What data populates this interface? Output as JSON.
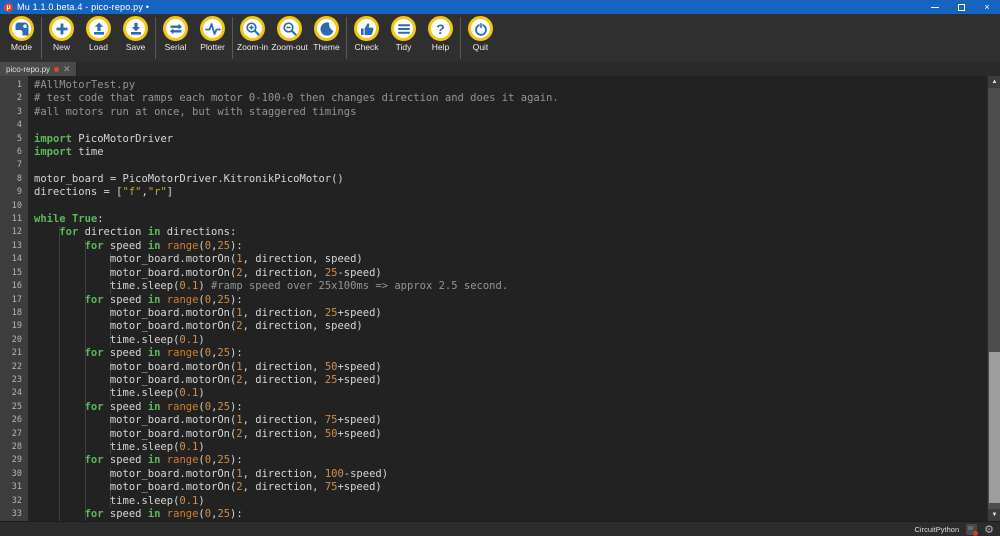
{
  "titlebar": {
    "title": "Mu 1.1.0.beta.4 - pico-repo.py •"
  },
  "toolbar": {
    "buttons": [
      {
        "name": "mode",
        "label": "Mode"
      },
      {
        "name": "new",
        "label": "New"
      },
      {
        "name": "load",
        "label": "Load"
      },
      {
        "name": "save",
        "label": "Save"
      },
      {
        "name": "serial",
        "label": "Serial"
      },
      {
        "name": "plotter",
        "label": "Plotter"
      },
      {
        "name": "zoom-in",
        "label": "Zoom-in"
      },
      {
        "name": "zoom-out",
        "label": "Zoom-out"
      },
      {
        "name": "theme",
        "label": "Theme"
      },
      {
        "name": "check",
        "label": "Check"
      },
      {
        "name": "tidy",
        "label": "Tidy"
      },
      {
        "name": "help",
        "label": "Help"
      },
      {
        "name": "quit",
        "label": "Quit"
      }
    ]
  },
  "tabbar": {
    "active_tab": "pico-repo.py"
  },
  "statusbar": {
    "mode": "CircuitPython"
  },
  "colors": {
    "titlebar_blue": "#1565c0",
    "icon_ring_yellow": "#f3c713",
    "icon_glyph_blue": "#2b6cb0",
    "editor_bg": "#222222",
    "keyword_green": "#5db85a",
    "number_orange": "#cf8f4e",
    "string_gold": "#cfa331",
    "comment_gray": "#949494",
    "modified_dot_red": "#e0492e"
  },
  "editor": {
    "lines": [
      {
        "tokens": [
          [
            "c",
            "#AllMotorTest.py"
          ]
        ]
      },
      {
        "tokens": [
          [
            "c",
            "# test code that ramps each motor 0-100-0 then changes direction and does it again."
          ]
        ]
      },
      {
        "tokens": [
          [
            "c",
            "#all motors run at once, but with staggered timings"
          ]
        ]
      },
      {
        "tokens": []
      },
      {
        "tokens": [
          [
            "k",
            "import"
          ],
          [
            "t",
            " PicoMotorDriver"
          ]
        ]
      },
      {
        "tokens": [
          [
            "k",
            "import"
          ],
          [
            "t",
            " time"
          ]
        ]
      },
      {
        "tokens": []
      },
      {
        "tokens": [
          [
            "t",
            "motor_board = PicoMotorDriver.KitronikPicoMotor()"
          ]
        ]
      },
      {
        "tokens": [
          [
            "t",
            "directions = ["
          ],
          [
            "s",
            "\"f\""
          ],
          [
            "t",
            ","
          ],
          [
            "s",
            "\"r\""
          ],
          [
            "t",
            "]"
          ]
        ]
      },
      {
        "tokens": []
      },
      {
        "tokens": [
          [
            "k",
            "while"
          ],
          [
            "t",
            " "
          ],
          [
            "k",
            "True"
          ],
          [
            "t",
            ":"
          ]
        ]
      },
      {
        "tokens": [
          [
            "t",
            "    "
          ],
          [
            "k",
            "for"
          ],
          [
            "t",
            " direction "
          ],
          [
            "k",
            "in"
          ],
          [
            "t",
            " directions:"
          ]
        ]
      },
      {
        "tokens": [
          [
            "t",
            "        "
          ],
          [
            "k",
            "for"
          ],
          [
            "t",
            " speed "
          ],
          [
            "k",
            "in"
          ],
          [
            "t",
            " "
          ],
          [
            "b",
            "range"
          ],
          [
            "t",
            "("
          ],
          [
            "n",
            "0"
          ],
          [
            "t",
            ","
          ],
          [
            "n",
            "25"
          ],
          [
            "t",
            "):"
          ]
        ]
      },
      {
        "tokens": [
          [
            "t",
            "            motor_board.motorOn("
          ],
          [
            "n",
            "1"
          ],
          [
            "t",
            ", direction, speed)"
          ]
        ]
      },
      {
        "tokens": [
          [
            "t",
            "            motor_board.motorOn("
          ],
          [
            "n",
            "2"
          ],
          [
            "t",
            ", direction, "
          ],
          [
            "n",
            "25"
          ],
          [
            "t",
            "-speed)"
          ]
        ]
      },
      {
        "tokens": [
          [
            "t",
            "            time.sleep("
          ],
          [
            "n",
            "0.1"
          ],
          [
            "t",
            ") "
          ],
          [
            "c",
            "#ramp speed over 25x100ms => approx 2.5 second."
          ]
        ]
      },
      {
        "tokens": [
          [
            "t",
            "        "
          ],
          [
            "k",
            "for"
          ],
          [
            "t",
            " speed "
          ],
          [
            "k",
            "in"
          ],
          [
            "t",
            " "
          ],
          [
            "b",
            "range"
          ],
          [
            "t",
            "("
          ],
          [
            "n",
            "0"
          ],
          [
            "t",
            ","
          ],
          [
            "n",
            "25"
          ],
          [
            "t",
            "):"
          ]
        ]
      },
      {
        "tokens": [
          [
            "t",
            "            motor_board.motorOn("
          ],
          [
            "n",
            "1"
          ],
          [
            "t",
            ", direction, "
          ],
          [
            "n",
            "25"
          ],
          [
            "t",
            "+speed)"
          ]
        ]
      },
      {
        "tokens": [
          [
            "t",
            "            motor_board.motorOn("
          ],
          [
            "n",
            "2"
          ],
          [
            "t",
            ", direction, speed)"
          ]
        ]
      },
      {
        "tokens": [
          [
            "t",
            "            time.sleep("
          ],
          [
            "n",
            "0.1"
          ],
          [
            "t",
            ")"
          ]
        ]
      },
      {
        "tokens": [
          [
            "t",
            "        "
          ],
          [
            "k",
            "for"
          ],
          [
            "t",
            " speed "
          ],
          [
            "k",
            "in"
          ],
          [
            "t",
            " "
          ],
          [
            "b",
            "range"
          ],
          [
            "t",
            "("
          ],
          [
            "n",
            "0"
          ],
          [
            "t",
            ","
          ],
          [
            "n",
            "25"
          ],
          [
            "t",
            "):"
          ]
        ]
      },
      {
        "tokens": [
          [
            "t",
            "            motor_board.motorOn("
          ],
          [
            "n",
            "1"
          ],
          [
            "t",
            ", direction, "
          ],
          [
            "n",
            "50"
          ],
          [
            "t",
            "+speed)"
          ]
        ]
      },
      {
        "tokens": [
          [
            "t",
            "            motor_board.motorOn("
          ],
          [
            "n",
            "2"
          ],
          [
            "t",
            ", direction, "
          ],
          [
            "n",
            "25"
          ],
          [
            "t",
            "+speed)"
          ]
        ]
      },
      {
        "tokens": [
          [
            "t",
            "            time.sleep("
          ],
          [
            "n",
            "0.1"
          ],
          [
            "t",
            ")"
          ]
        ]
      },
      {
        "tokens": [
          [
            "t",
            "        "
          ],
          [
            "k",
            "for"
          ],
          [
            "t",
            " speed "
          ],
          [
            "k",
            "in"
          ],
          [
            "t",
            " "
          ],
          [
            "b",
            "range"
          ],
          [
            "t",
            "("
          ],
          [
            "n",
            "0"
          ],
          [
            "t",
            ","
          ],
          [
            "n",
            "25"
          ],
          [
            "t",
            "):"
          ]
        ]
      },
      {
        "tokens": [
          [
            "t",
            "            motor_board.motorOn("
          ],
          [
            "n",
            "1"
          ],
          [
            "t",
            ", direction, "
          ],
          [
            "n",
            "75"
          ],
          [
            "t",
            "+speed)"
          ]
        ]
      },
      {
        "tokens": [
          [
            "t",
            "            motor_board.motorOn("
          ],
          [
            "n",
            "2"
          ],
          [
            "t",
            ", direction, "
          ],
          [
            "n",
            "50"
          ],
          [
            "t",
            "+speed)"
          ]
        ]
      },
      {
        "tokens": [
          [
            "t",
            "            time.sleep("
          ],
          [
            "n",
            "0.1"
          ],
          [
            "t",
            ")"
          ]
        ]
      },
      {
        "tokens": [
          [
            "t",
            "        "
          ],
          [
            "k",
            "for"
          ],
          [
            "t",
            " speed "
          ],
          [
            "k",
            "in"
          ],
          [
            "t",
            " "
          ],
          [
            "b",
            "range"
          ],
          [
            "t",
            "("
          ],
          [
            "n",
            "0"
          ],
          [
            "t",
            ","
          ],
          [
            "n",
            "25"
          ],
          [
            "t",
            "):"
          ]
        ]
      },
      {
        "tokens": [
          [
            "t",
            "            motor_board.motorOn("
          ],
          [
            "n",
            "1"
          ],
          [
            "t",
            ", direction, "
          ],
          [
            "n",
            "100"
          ],
          [
            "t",
            "-speed)"
          ]
        ]
      },
      {
        "tokens": [
          [
            "t",
            "            motor_board.motorOn("
          ],
          [
            "n",
            "2"
          ],
          [
            "t",
            ", direction, "
          ],
          [
            "n",
            "75"
          ],
          [
            "t",
            "+speed)"
          ]
        ]
      },
      {
        "tokens": [
          [
            "t",
            "            time.sleep("
          ],
          [
            "n",
            "0.1"
          ],
          [
            "t",
            ")"
          ]
        ]
      },
      {
        "tokens": [
          [
            "t",
            "        "
          ],
          [
            "k",
            "for"
          ],
          [
            "t",
            " speed "
          ],
          [
            "k",
            "in"
          ],
          [
            "t",
            " "
          ],
          [
            "b",
            "range"
          ],
          [
            "t",
            "("
          ],
          [
            "n",
            "0"
          ],
          [
            "t",
            ","
          ],
          [
            "n",
            "25"
          ],
          [
            "t",
            "):"
          ]
        ]
      }
    ]
  }
}
